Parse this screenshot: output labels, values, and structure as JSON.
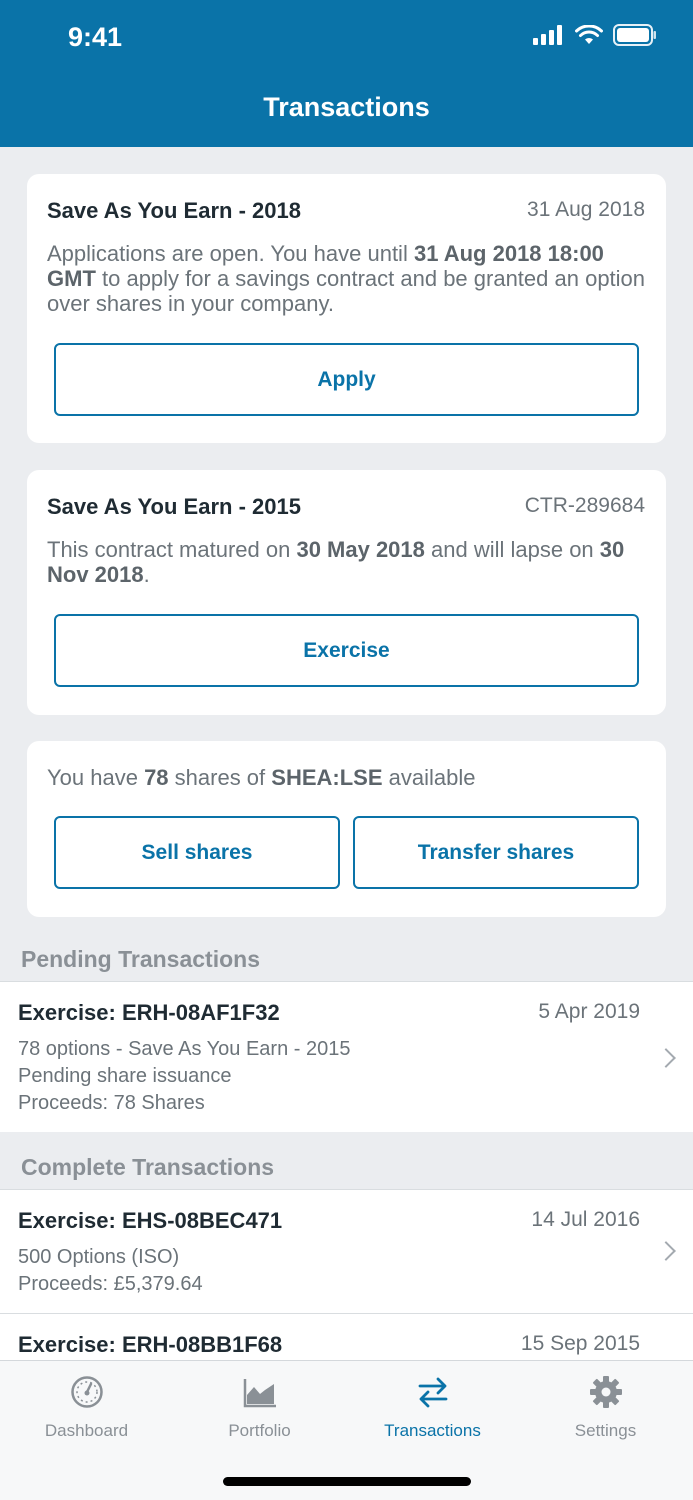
{
  "status_bar": {
    "time": "9:41"
  },
  "header": {
    "title": "Transactions"
  },
  "cards": {
    "saye2018": {
      "title": "Save As You Earn - 2018",
      "date": "31 Aug 2018",
      "text_1": "Applications are open. You have until ",
      "bold_1": "31 Aug 2018 18:00 GMT",
      "text_2": " to apply for a savings contract and be granted an option over shares in your company.",
      "button_label": "Apply"
    },
    "saye2015": {
      "title": "Save As You Earn - 2015",
      "ref": "CTR-289684",
      "text_1": "This contract matured on ",
      "bold_1": "30 May 2018",
      "text_2": " and will lapse on ",
      "bold_2": "30 Nov 2018",
      "text_3": ".",
      "button_label": "Exercise"
    },
    "shares": {
      "text_1": "You have ",
      "bold_count": "78",
      "text_2": " shares of ",
      "bold_ticker": "SHEA:LSE",
      "text_3": " available",
      "sell_label": "Sell shares",
      "transfer_label": "Transfer shares"
    }
  },
  "pending": {
    "section_title": "Pending Transactions",
    "items": [
      {
        "title": "Exercise: ERH-08AF1F32",
        "date": "5 Apr 2019",
        "line1": "78 options - Save As You Earn - 2015",
        "line2": "Pending share issuance",
        "line3": "Proceeds: 78 Shares"
      }
    ]
  },
  "complete": {
    "section_title": "Complete Transactions",
    "items": [
      {
        "title": "Exercise: EHS-08BEC471",
        "date": "14 Jul 2016",
        "line1": "500 Options (ISO)",
        "line2": "Proceeds: £5,379.64"
      },
      {
        "title": "Exercise: ERH-08BB1F68",
        "date": "15 Sep 2015"
      }
    ]
  },
  "tabbar": {
    "items": [
      {
        "label": "Dashboard",
        "icon": "gauge-icon"
      },
      {
        "label": "Portfolio",
        "icon": "chart-icon"
      },
      {
        "label": "Transactions",
        "icon": "swap-arrows-icon"
      },
      {
        "label": "Settings",
        "icon": "gear-icon"
      }
    ],
    "active": "Transactions",
    "active_color": "#0a73a8",
    "inactive_color": "#8a9096"
  },
  "colors": {
    "brand": "#0a73a8",
    "background": "#ebedf0"
  }
}
